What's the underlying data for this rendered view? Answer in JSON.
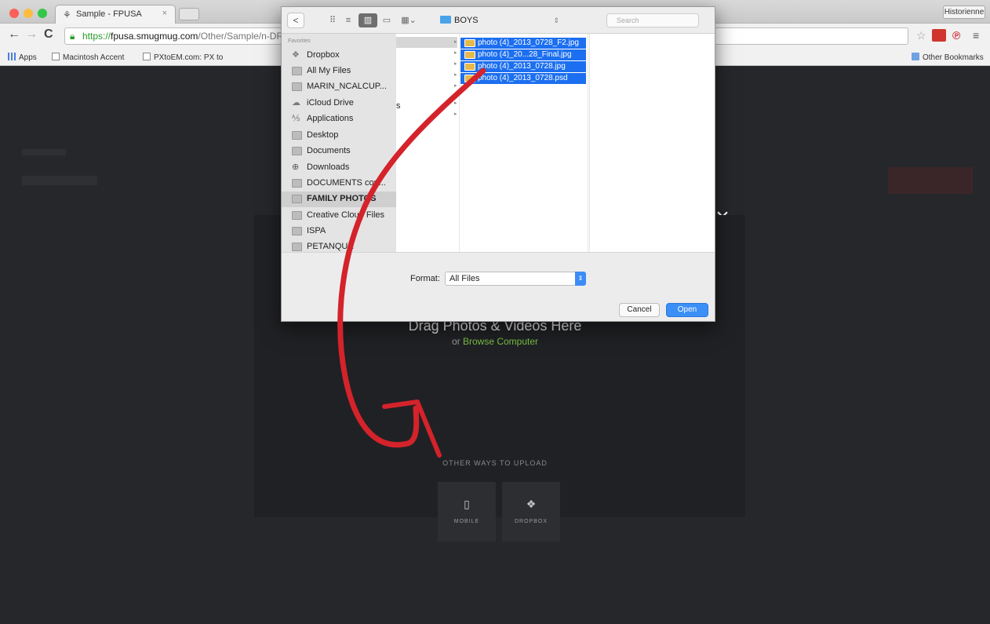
{
  "browser": {
    "tab_title": "Sample - FPUSA",
    "tab_close": "×",
    "user_name": "Historienne",
    "url_scheme": "https://",
    "url_host": "fpusa.smugmug.com",
    "url_path": "/Other/Sample/n-DR9",
    "bookmarks": [
      {
        "label": "Apps"
      },
      {
        "label": "Macintosh Accent"
      },
      {
        "label": "PXtoEM.com: PX to"
      }
    ],
    "other_bookmarks": "Other Bookmarks"
  },
  "dialog": {
    "back": "<",
    "current_folder": "BOYS",
    "search_placeholder": "Search",
    "sidebar_heading": "Favorites",
    "sidebar_items": [
      {
        "label": "Dropbox"
      },
      {
        "label": "All My Files"
      },
      {
        "label": "MARIN_NCALCUP..."
      },
      {
        "label": "iCloud Drive"
      },
      {
        "label": "Applications"
      },
      {
        "label": "Desktop"
      },
      {
        "label": "Documents"
      },
      {
        "label": "Downloads"
      },
      {
        "label": "DOCUMENTS cop..."
      },
      {
        "label": "FAMILY PHOTOS"
      },
      {
        "label": "Creative Cloud Files"
      },
      {
        "label": "ISPA"
      },
      {
        "label": "PETANQUE"
      }
    ],
    "files": [
      {
        "name": "photo (4)_2013_0728_F2.jpg"
      },
      {
        "name": "photo (4)_20...28_Final.jpg"
      },
      {
        "name": "photo (4)_2013_0728.jpg"
      },
      {
        "name": "photo (4)_2013_0728.psd"
      }
    ],
    "column_fragment": "s",
    "format_label": "Format:",
    "format_value": "All Files",
    "cancel": "Cancel",
    "open": "Open"
  },
  "upload": {
    "drag_title": "Drag Photos & Videos Here",
    "or_text": "or",
    "browse_link": "Browse Computer",
    "other_ways": "OTHER WAYS TO UPLOAD",
    "options": [
      {
        "label": "MOBILE",
        "icon": "mobile-icon"
      },
      {
        "label": "DROPBOX",
        "icon": "dropbox-icon"
      }
    ],
    "close_symbol": "×"
  },
  "colors": {
    "page_bg": "#26272a",
    "browse_link": "#7ac143",
    "selection_blue": "#1c6ff0",
    "annotation_red": "#d4232b"
  }
}
